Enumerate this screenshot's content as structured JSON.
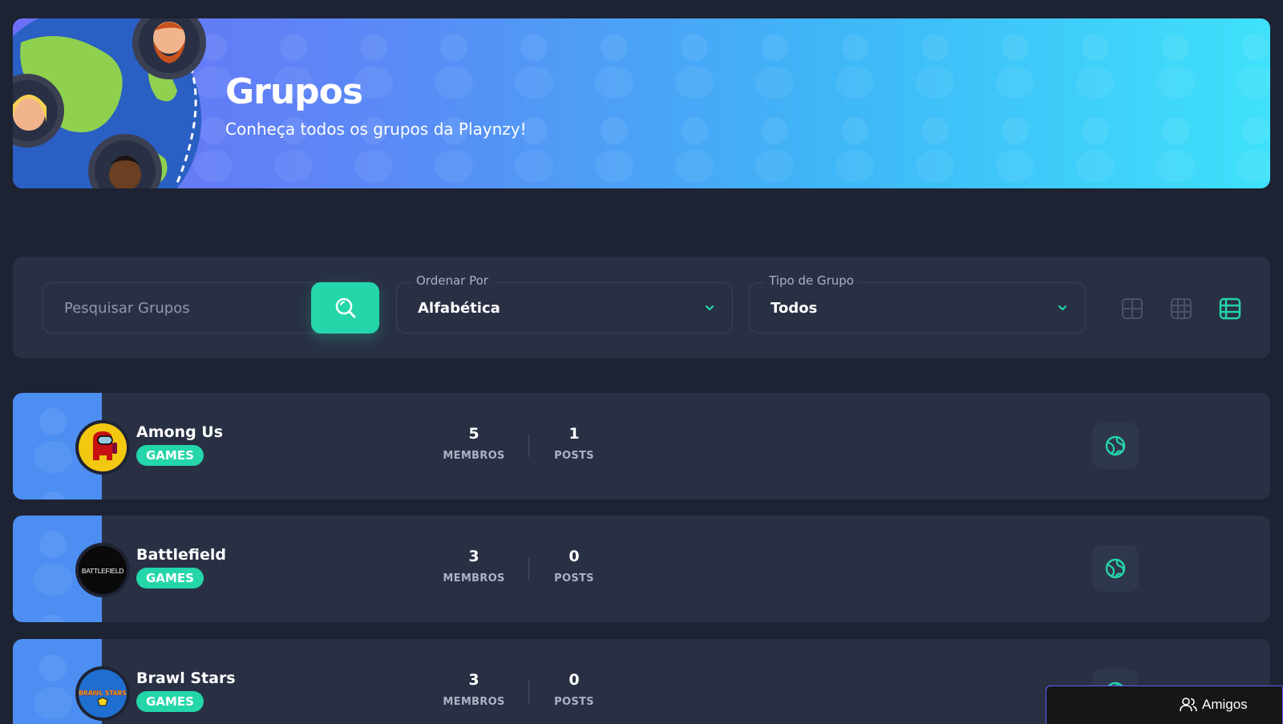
{
  "banner": {
    "title": "Grupos",
    "subtitle": "Conheça todos os grupos da Playnzy!"
  },
  "filters": {
    "search_placeholder": "Pesquisar Grupos",
    "search_value": "",
    "order": {
      "label": "Ordenar Por",
      "value": "Alfabética"
    },
    "type": {
      "label": "Tipo de Grupo",
      "value": "Todos"
    },
    "views": [
      "big-grid-icon",
      "small-grid-icon",
      "list-icon"
    ],
    "active_view": "list-icon"
  },
  "groups": [
    {
      "name": "Among Us",
      "category": "GAMES",
      "members": "5",
      "members_label": "MEMBROS",
      "posts": "1",
      "posts_label": "POSTS"
    },
    {
      "name": "Battlefield",
      "category": "GAMES",
      "members": "3",
      "members_label": "MEMBROS",
      "posts": "0",
      "posts_label": "POSTS",
      "logo_text": "BATTLEFIELD"
    },
    {
      "name": "Brawl Stars",
      "category": "GAMES",
      "members": "3",
      "members_label": "MEMBROS",
      "posts": "0",
      "posts_label": "POSTS",
      "logo_text": "BRAWL STARS"
    }
  ],
  "chat": {
    "label": "Amigos"
  },
  "colors": {
    "background": "#1d2333",
    "card": "#293044",
    "accent": "#24d6a9",
    "banner_start": "#6c6ff6",
    "banner_end": "#3fe1fb"
  }
}
